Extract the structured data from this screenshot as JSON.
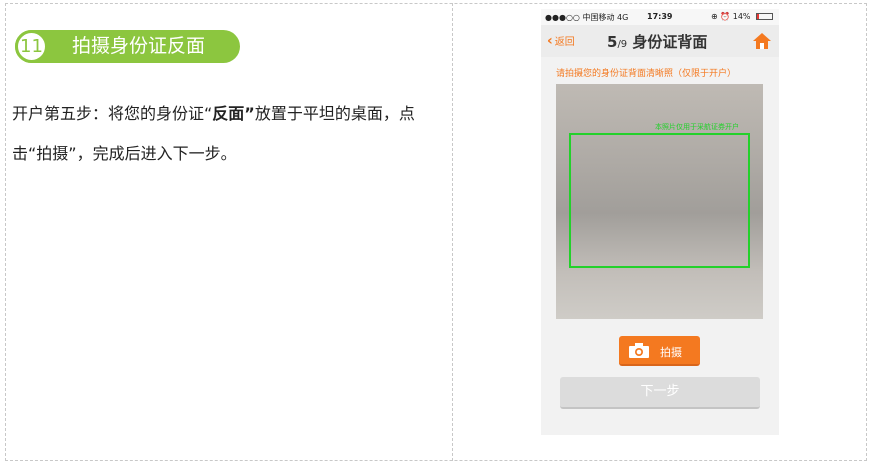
{
  "step": {
    "number": "11",
    "title": "拍摄身份证反面"
  },
  "description": {
    "part1": "开户第五步：将您的身份证“",
    "emphasis": "反面”",
    "part2": "放置于平坦的桌面，点击“拍摄”，完成后进入下一步。"
  },
  "phone": {
    "status_bar": {
      "carrier": "●●●○○ 中国移动  4G",
      "time": "17:39",
      "right": "⊕ ⏰ 14%",
      "battery_percent": 14
    },
    "nav": {
      "back_label": "返回",
      "step_current": "5",
      "step_total": "/9",
      "title": "身份证背面"
    },
    "hint": "请拍摄您的身份证背面清晰照（仅限于开户）",
    "watermark": "本照片仅用于采航证券开户",
    "shoot_button": "拍摄",
    "next_button": "下一步",
    "colors": {
      "accent": "#f47920",
      "step_green": "#8cc63f",
      "frame_green": "#23d12b"
    }
  }
}
